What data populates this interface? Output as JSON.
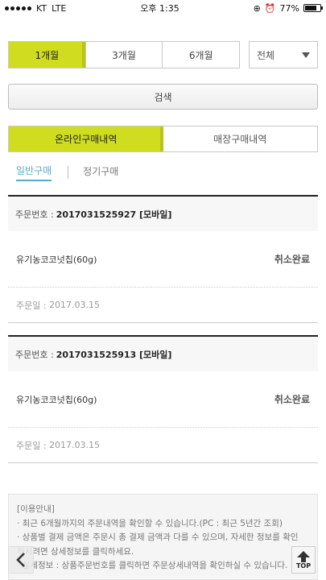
{
  "status_bar": {
    "carrier": "KT",
    "network": "LTE",
    "time": "오후 1:35",
    "battery": "77%",
    "battery_level": 0.77
  },
  "period": {
    "options": [
      {
        "label": "1개월",
        "selected": true
      },
      {
        "label": "3개월",
        "selected": false
      },
      {
        "label": "6개월",
        "selected": false
      }
    ],
    "filter_value": "전체"
  },
  "search_label": "검색",
  "tabs": [
    {
      "label": "온라인구매내역",
      "selected": true
    },
    {
      "label": "매장구매내역",
      "selected": false
    }
  ],
  "subtabs": [
    {
      "label": "일반구매",
      "selected": true
    },
    {
      "label": "정기구매",
      "selected": false
    }
  ],
  "labels": {
    "order_no": "주문번호 :",
    "order_date": "주문일 :"
  },
  "orders": [
    {
      "order_no": "2017031525927 [모바일]",
      "product": "유기농코코넛칩(60g)",
      "status": "취소완료",
      "date": "2017.03.15"
    },
    {
      "order_no": "2017031525913 [모바일]",
      "product": "유기농코코넛칩(60g)",
      "status": "취소완료",
      "date": "2017.03.15"
    }
  ],
  "notice": {
    "title": "[이용안내]",
    "lines": [
      "· 최근 6개월까지의 주문내역을 확인할 수 있습니다.(PC : 최근 5년간 조회)",
      "· 상품별 결제 금액은 주문시 총 결제 금액과 다를 수 있으며, 자세한 정보를 확인",
      "   하시려면 상세정보를 클릭하세요.",
      "· 상세정보 : 상품주문번호를 클릭하면 주문상세내역을 확인하실 수 있습니다."
    ]
  },
  "nav": {
    "top_label": "TOP"
  },
  "colors": {
    "accent": "#cfdc20",
    "subtab_active": "#5aaac7"
  }
}
